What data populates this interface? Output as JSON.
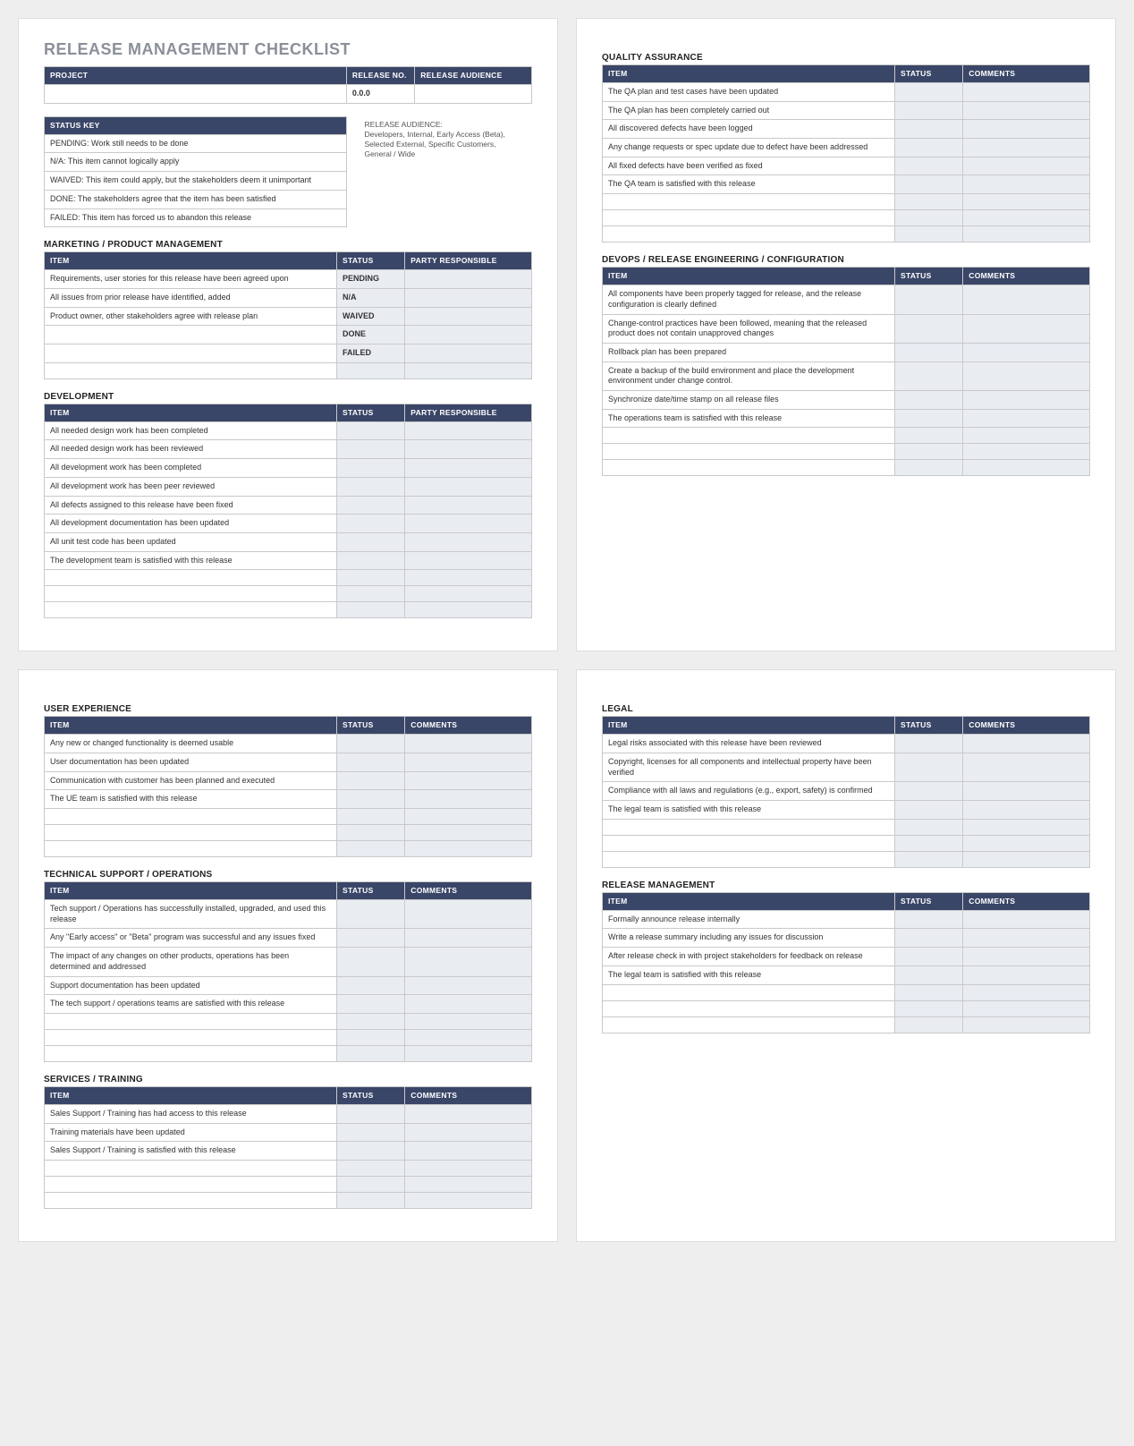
{
  "doc_title": "RELEASE MANAGEMENT CHECKLIST",
  "project_table": {
    "headers": [
      "PROJECT",
      "RELEASE NO.",
      "RELEASE AUDIENCE"
    ],
    "row": [
      "",
      "0.0.0",
      ""
    ]
  },
  "status_key": {
    "header": "STATUS KEY",
    "rows": [
      "PENDING:  Work still needs to be done",
      "N/A: This item cannot logically apply",
      "WAIVED: This item could apply, but the stakeholders deem it unimportant",
      "DONE: The stakeholders agree that the item has been satisfied",
      "FAILED: This item has forced us to abandon this release"
    ]
  },
  "audience_note": {
    "label": "RELEASE AUDIENCE:",
    "body": "Developers, Internal, Early Access (Beta), Selected External, Specific Customers, General / Wide"
  },
  "col_headers_party": [
    "ITEM",
    "STATUS",
    "PARTY RESPONSIBLE"
  ],
  "col_headers_comments": [
    "ITEM",
    "STATUS",
    "COMMENTS"
  ],
  "sections": {
    "marketing": {
      "title": "MARKETING / PRODUCT MANAGEMENT",
      "headers_key": "col_headers_party",
      "rows": [
        {
          "item": "Requirements, user stories for this release have been agreed upon",
          "status": "PENDING",
          "third": ""
        },
        {
          "item": "All issues from prior release have identified, added",
          "status": "N/A",
          "third": ""
        },
        {
          "item": "Product owner, other stakeholders agree with release plan",
          "status": "WAIVED",
          "third": ""
        },
        {
          "item": "",
          "status": "DONE",
          "third": ""
        },
        {
          "item": "",
          "status": "FAILED",
          "third": ""
        },
        {
          "item": "",
          "status": "",
          "third": ""
        }
      ]
    },
    "development": {
      "title": "DEVELOPMENT",
      "headers_key": "col_headers_party",
      "rows": [
        {
          "item": "All needed design work has been completed",
          "status": "",
          "third": ""
        },
        {
          "item": "All needed design work has been reviewed",
          "status": "",
          "third": ""
        },
        {
          "item": "All development work has been completed",
          "status": "",
          "third": ""
        },
        {
          "item": "All development work has been peer reviewed",
          "status": "",
          "third": ""
        },
        {
          "item": "All defects assigned to this release have been fixed",
          "status": "",
          "third": ""
        },
        {
          "item": "All development documentation has been updated",
          "status": "",
          "third": ""
        },
        {
          "item": "All unit test code has been updated",
          "status": "",
          "third": ""
        },
        {
          "item": "The development team is satisfied with this release",
          "status": "",
          "third": ""
        },
        {
          "item": "",
          "status": "",
          "third": ""
        },
        {
          "item": "",
          "status": "",
          "third": ""
        },
        {
          "item": "",
          "status": "",
          "third": ""
        }
      ]
    },
    "qa": {
      "title": "QUALITY ASSURANCE",
      "headers_key": "col_headers_comments",
      "rows": [
        {
          "item": "The QA plan and test cases have been updated",
          "status": "",
          "third": ""
        },
        {
          "item": "The QA plan has been completely carried out",
          "status": "",
          "third": ""
        },
        {
          "item": "All discovered defects have been logged",
          "status": "",
          "third": ""
        },
        {
          "item": "Any change requests or spec update due to defect have been addressed",
          "status": "",
          "third": ""
        },
        {
          "item": "All fixed defects have been verified as fixed",
          "status": "",
          "third": ""
        },
        {
          "item": "The QA team is satisfied with this release",
          "status": "",
          "third": ""
        },
        {
          "item": "",
          "status": "",
          "third": ""
        },
        {
          "item": "",
          "status": "",
          "third": ""
        },
        {
          "item": "",
          "status": "",
          "third": ""
        }
      ]
    },
    "devops": {
      "title": "DevOps / RELEASE ENGINEERING / CONFIGURATION",
      "headers_key": "col_headers_comments",
      "rows": [
        {
          "item": "All components have been properly tagged for release, and the release configuration is clearly defined",
          "status": "",
          "third": ""
        },
        {
          "item": "Change-control practices have been followed, meaning that the released product does not contain unapproved changes",
          "status": "",
          "third": ""
        },
        {
          "item": "Rollback plan has been prepared",
          "status": "",
          "third": ""
        },
        {
          "item": "Create a backup of the build environment and place the development environment under change control.",
          "status": "",
          "third": ""
        },
        {
          "item": "Synchronize date/time stamp on all release files",
          "status": "",
          "third": ""
        },
        {
          "item": "The operations team is satisfied with this release",
          "status": "",
          "third": ""
        },
        {
          "item": "",
          "status": "",
          "third": ""
        },
        {
          "item": "",
          "status": "",
          "third": ""
        },
        {
          "item": "",
          "status": "",
          "third": ""
        }
      ]
    },
    "ux": {
      "title": "USER EXPERIENCE",
      "headers_key": "col_headers_comments",
      "rows": [
        {
          "item": "Any new or changed functionality is deemed usable",
          "status": "",
          "third": ""
        },
        {
          "item": "User documentation has been updated",
          "status": "",
          "third": ""
        },
        {
          "item": "Communication with customer has been planned and executed",
          "status": "",
          "third": ""
        },
        {
          "item": "The UE team is satisfied with this release",
          "status": "",
          "third": ""
        },
        {
          "item": "",
          "status": "",
          "third": ""
        },
        {
          "item": "",
          "status": "",
          "third": ""
        },
        {
          "item": "",
          "status": "",
          "third": ""
        }
      ]
    },
    "tech_support": {
      "title": "TECHNICAL SUPPORT / OPERATIONS",
      "headers_key": "col_headers_comments",
      "rows": [
        {
          "item": "Tech support / Operations has successfully installed, upgraded, and used this release",
          "status": "",
          "third": ""
        },
        {
          "item": "Any \"Early access\" or \"Beta\" program was successful and any issues fixed",
          "status": "",
          "third": ""
        },
        {
          "item": "The impact of any changes on other products, operations has been determined and addressed",
          "status": "",
          "third": ""
        },
        {
          "item": "Support documentation has been updated",
          "status": "",
          "third": ""
        },
        {
          "item": "The tech support / operations teams are satisfied with this release",
          "status": "",
          "third": ""
        },
        {
          "item": "",
          "status": "",
          "third": ""
        },
        {
          "item": "",
          "status": "",
          "third": ""
        },
        {
          "item": "",
          "status": "",
          "third": ""
        }
      ]
    },
    "services": {
      "title": "SERVICES / TRAINING",
      "headers_key": "col_headers_comments",
      "rows": [
        {
          "item": "Sales Support / Training has had access to this release",
          "status": "",
          "third": ""
        },
        {
          "item": "Training materials have been updated",
          "status": "",
          "third": ""
        },
        {
          "item": "Sales Support / Training is satisfied with this release",
          "status": "",
          "third": ""
        },
        {
          "item": "",
          "status": "",
          "third": ""
        },
        {
          "item": "",
          "status": "",
          "third": ""
        },
        {
          "item": "",
          "status": "",
          "third": ""
        }
      ]
    },
    "legal": {
      "title": "LEGAL",
      "headers_key": "col_headers_comments",
      "rows": [
        {
          "item": "Legal risks associated with this release have been reviewed",
          "status": "",
          "third": ""
        },
        {
          "item": "Copyright, licenses for all components and intellectual property have been verified",
          "status": "",
          "third": ""
        },
        {
          "item": "Compliance with all laws and regulations (e.g., export, safety) is confirmed",
          "status": "",
          "third": ""
        },
        {
          "item": "The legal team is satisfied with this release",
          "status": "",
          "third": ""
        },
        {
          "item": "",
          "status": "",
          "third": ""
        },
        {
          "item": "",
          "status": "",
          "third": ""
        },
        {
          "item": "",
          "status": "",
          "third": ""
        }
      ]
    },
    "release_mgmt": {
      "title": "RELEASE MANAGEMENT",
      "headers_key": "col_headers_comments",
      "rows": [
        {
          "item": "Formally announce release internally",
          "status": "",
          "third": ""
        },
        {
          "item": "Write a release summary including any issues for discussion",
          "status": "",
          "third": ""
        },
        {
          "item": "After release check in with project stakeholders for feedback on release",
          "status": "",
          "third": ""
        },
        {
          "item": "The legal team is satisfied with this release",
          "status": "",
          "third": ""
        },
        {
          "item": "",
          "status": "",
          "third": ""
        },
        {
          "item": "",
          "status": "",
          "third": ""
        },
        {
          "item": "",
          "status": "",
          "third": ""
        }
      ]
    }
  }
}
